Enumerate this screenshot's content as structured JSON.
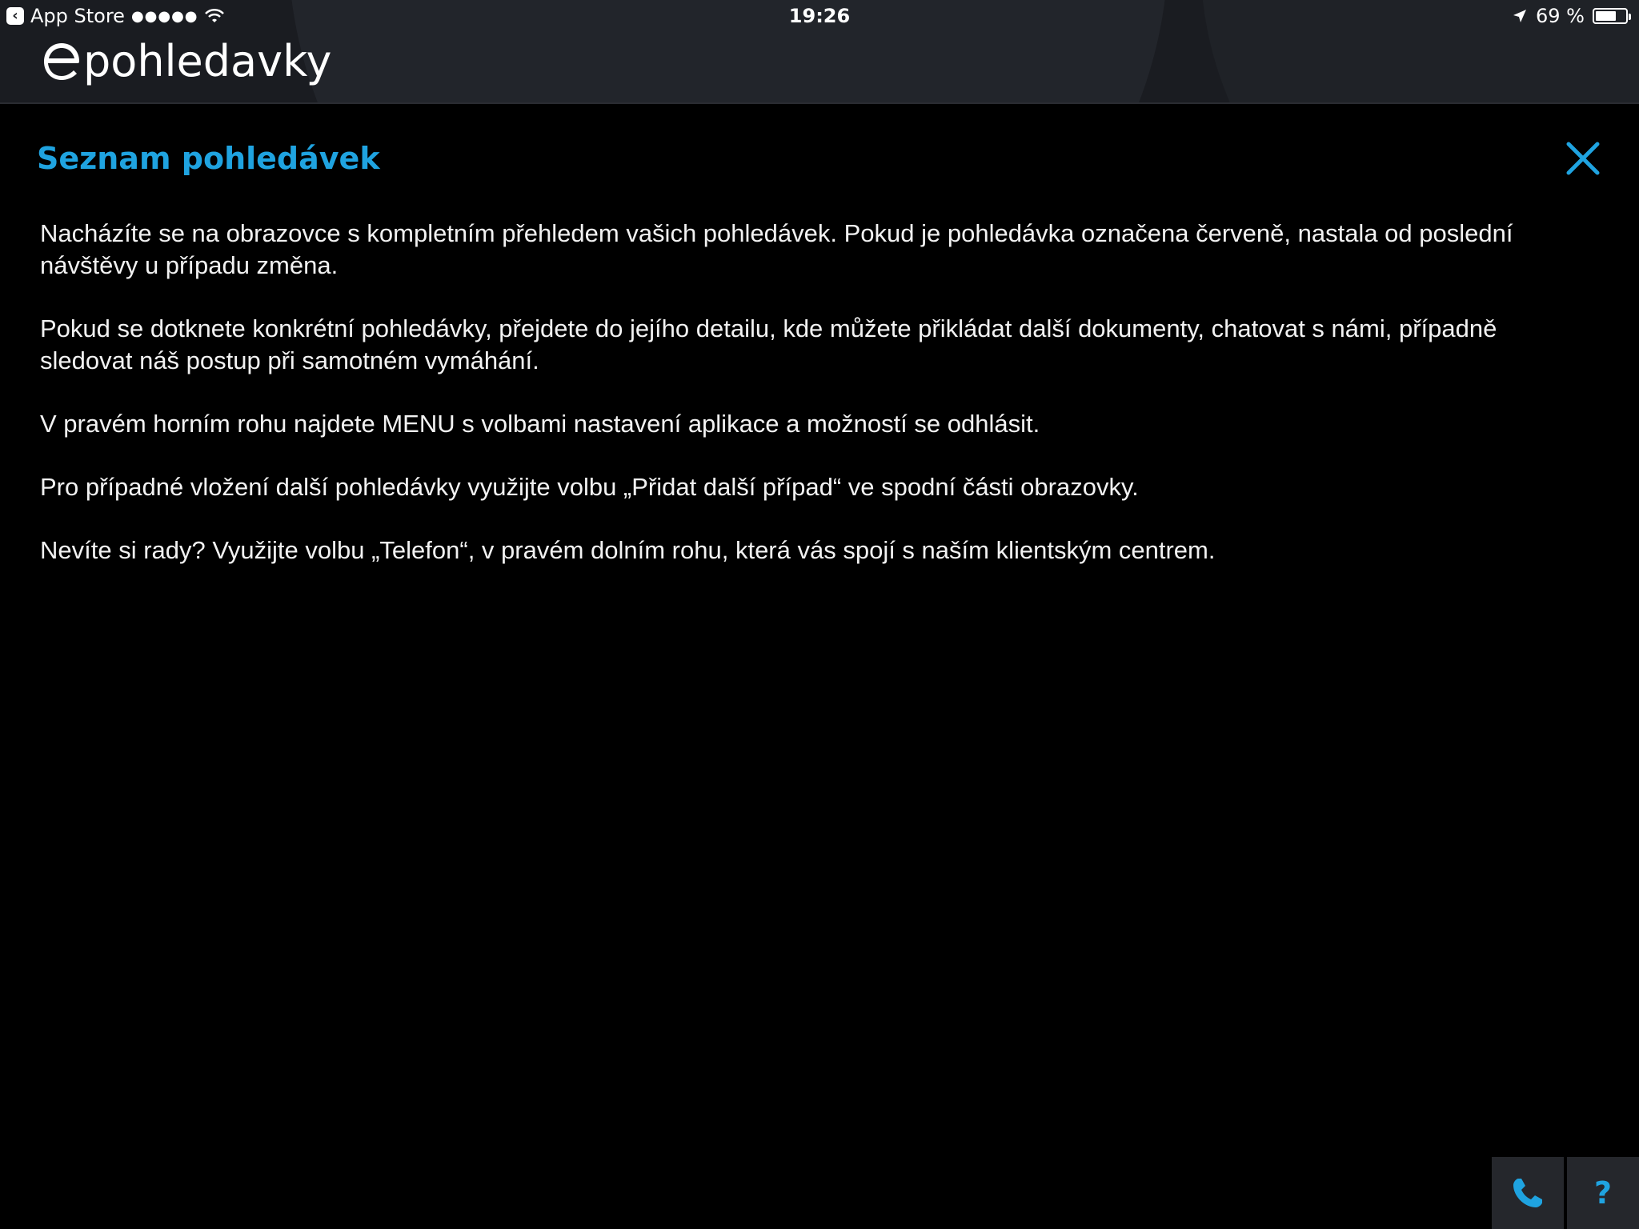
{
  "status_bar": {
    "back_app": "App Store",
    "signal": "●●●●●",
    "time": "19:26",
    "battery_text": "69 %",
    "battery_level": 0.69
  },
  "header": {
    "logo_text": "pohledavky"
  },
  "main": {
    "title": "Seznam pohledávek",
    "paragraphs": [
      "Nacházíte se na obrazovce s kompletním přehledem vašich pohledávek. Pokud je pohledávka označena červeně, nastala od poslední návštěvy u případu změna.",
      "Pokud se dotknete konkrétní pohledávky, přejdete do jejího detailu, kde můžete přikládat další dokumenty, chatovat s námi, případně sledovat náš postup při samotném vymáhání.",
      "V pravém horním rohu najdete MENU s volbami nastavení aplikace a možností se odhlásit.",
      "Pro případné vložení další pohledávky využijte volbu „Přidat další případ“ ve spodní části obrazovky.",
      "Nevíte si rady? Využijte volbu „Telefon“, v pravém dolním rohu, která vás spojí s naším klientským centrem."
    ]
  },
  "footer": {
    "help_label": "?"
  },
  "icons": {
    "close": "close-icon",
    "phone": "phone-icon",
    "wifi": "wifi-icon",
    "location": "location-arrow-icon",
    "battery": "battery-icon",
    "back": "back-chevron-icon"
  },
  "colors": {
    "accent": "#1fa3e0",
    "background": "#000000",
    "header": "#1a1c21",
    "button": "#25272c"
  }
}
